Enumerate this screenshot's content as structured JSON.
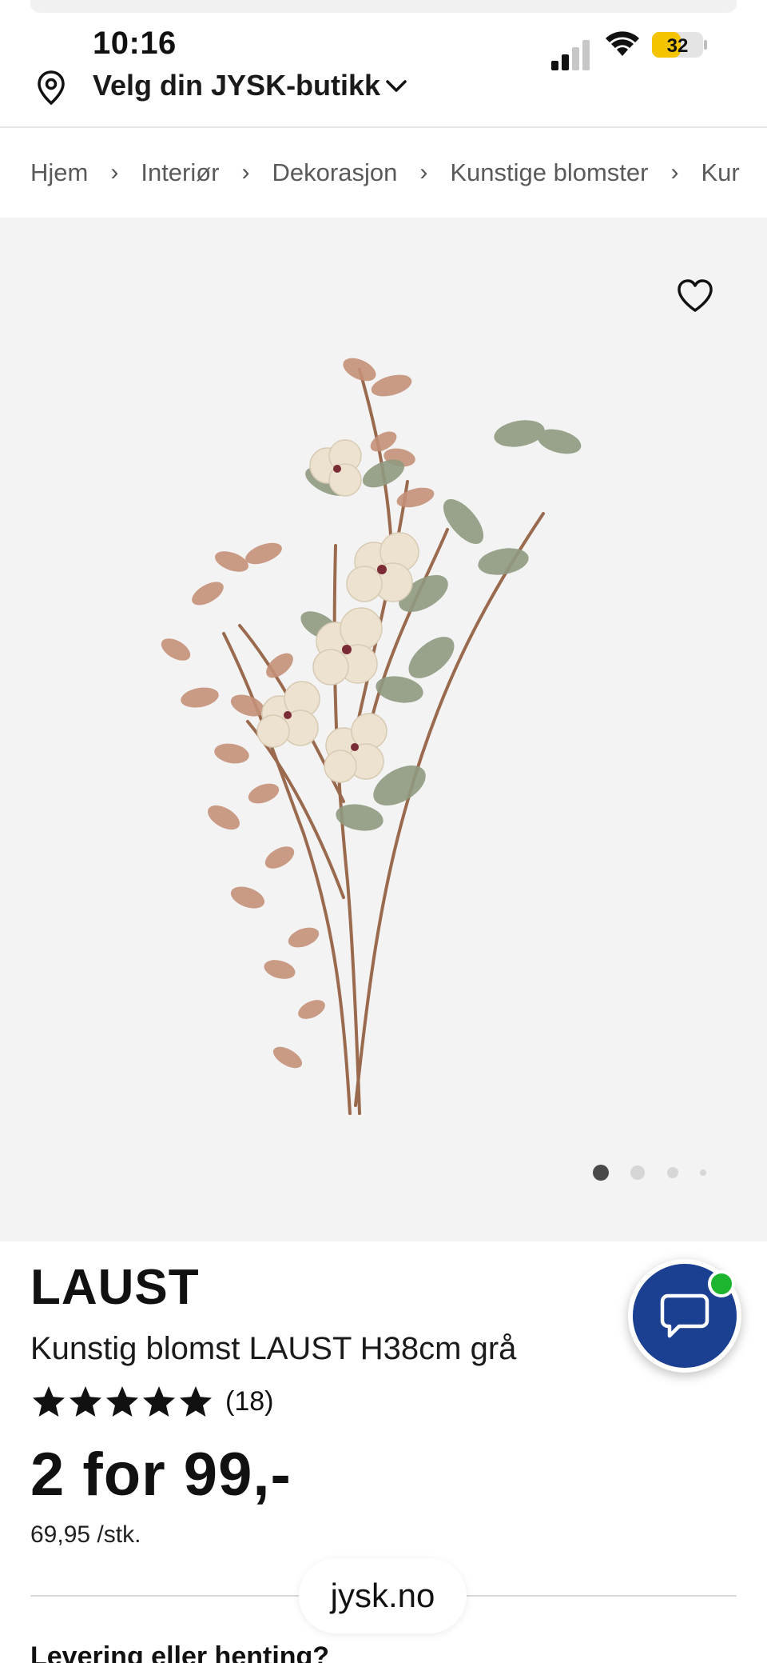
{
  "status_bar": {
    "time": "10:16",
    "battery_level": "32"
  },
  "store": {
    "label": "Velg din JYSK-butikk"
  },
  "breadcrumb": [
    {
      "label": "Hjem"
    },
    {
      "label": "Interiør"
    },
    {
      "label": "Dekorasjon"
    },
    {
      "label": "Kunstige blomster"
    },
    {
      "label": "Kur"
    }
  ],
  "gallery": {
    "image_count": 4,
    "active_index": 0
  },
  "product": {
    "name": "LAUST",
    "description": "Kunstig blomst LAUST H38cm grå",
    "rating_stars": 5,
    "review_count": "(18)",
    "price": "2 for 99,-",
    "unit_price": "69,95 /stk."
  },
  "browser": {
    "url": "jysk.no"
  },
  "section": {
    "delivery_heading": "Levering eller henting?"
  },
  "colors": {
    "chat_button": "#1b3f91",
    "online_indicator": "#1db52f",
    "battery_fill": "#f5c400",
    "gallery_bg": "#f3f3f3"
  }
}
